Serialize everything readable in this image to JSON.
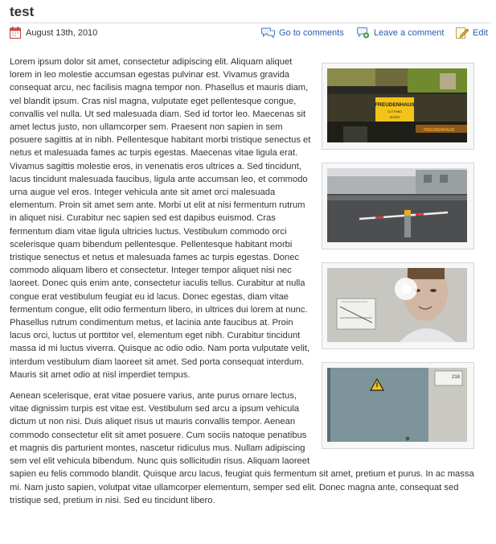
{
  "post": {
    "title": "test",
    "date": "August 13th, 2010",
    "actions": {
      "comments": "Go to comments",
      "leave_comment": "Leave a comment",
      "edit": "Edit"
    }
  },
  "icons": {
    "date": "calendar-icon",
    "comments": "speech-bubble-icon",
    "leave_comment": "add-comment-icon",
    "edit": "pencil-icon"
  },
  "colors": {
    "link": "#2a5db0",
    "text": "#333333",
    "rule": "#dcdcdc"
  },
  "content": {
    "paragraph1": "Lorem ipsum dolor sit amet, consectetur adipiscing elit. Aliquam aliquet lorem in leo molestie accumsan egestas pulvinar est. Vivamus gravida consequat arcu, nec facilisis magna tempor non. Phasellus et mauris diam, vel blandit ipsum. Cras nisl magna, vulputate eget pellentesque congue, convallis vel nulla. Ut sed malesuada diam. Sed id tortor leo. Maecenas sit amet lectus justo, non ullamcorper sem. Praesent non sapien in sem posuere sagittis at in nibh. Pellentesque habitant morbi tristique senectus et netus et malesuada fames ac turpis egestas. Maecenas vitae ligula erat. Vivamus sagittis molestie eros, in venenatis eros ultrices a. Sed tincidunt, lacus tincidunt malesuada faucibus, ligula ante accumsan leo, et commodo urna augue vel eros. Integer vehicula ante sit amet orci malesuada elementum. Proin sit amet sem ante. Morbi ut elit at nisi fermentum rutrum in aliquet nisi. Curabitur nec sapien sed est dapibus euismod. Cras fermentum diam vitae ligula ultricies luctus. Vestibulum commodo orci scelerisque quam bibendum pellentesque. Pellentesque habitant morbi tristique senectus et netus et malesuada fames ac turpis egestas. Donec commodo aliquam libero et consectetur. Integer tempor aliquet nisi nec laoreet. Donec quis enim ante, consectetur iaculis tellus. Curabitur at nulla congue erat vestibulum feugiat eu id lacus. Donec egestas, diam vitae fermentum congue, elit odio fermentum libero, in ultrices dui lorem at nunc. Phasellus rutrum condimentum metus, et lacinia ante faucibus at. Proin lacus orci, luctus ut porttitor vel, elementum eget nibh. Curabitur tincidunt massa id mi luctus viverra. Quisque ac odio odio. Nam porta vulputate velit, interdum vestibulum diam laoreet sit amet. Sed porta consequat interdum. Mauris sit amet odio at nisl imperdiet tempus.",
    "paragraph2": "Aenean scelerisque, erat vitae posuere varius, ante purus ornare lectus, vitae dignissim turpis est vitae est. Vestibulum sed arcu a ipsum vehicula dictum ut non nisi. Duis aliquet risus ut mauris convallis tempor. Aenean commodo consectetur elit sit amet posuere. Cum sociis natoque penatibus et magnis dis parturient montes, nascetur ridiculus mus. Nullam adipiscing sem vel elit vehicula bibendum. Nunc quis sollicitudin risus. Aliquam laoreet sapien eu felis commodo blandit. Quisque arcu lacus, feugiat quis fermentum sit amet, pretium et purus. In ac massa mi. Nam justo sapien, volutpat vitae ullamcorper elementum, semper sed elit. Donec magna ante, consequat sed tristique sed, pretium in nisi. Sed eu tincidunt libero."
  },
  "images": {
    "photo1": {
      "sign_line1": "FREUDENHAUS",
      "sign_line2": "CLOTHING",
      "sign_line3": "SHOES",
      "awning_text": "FREUDENHAUS"
    },
    "photo4": {
      "door_label": "218"
    }
  }
}
